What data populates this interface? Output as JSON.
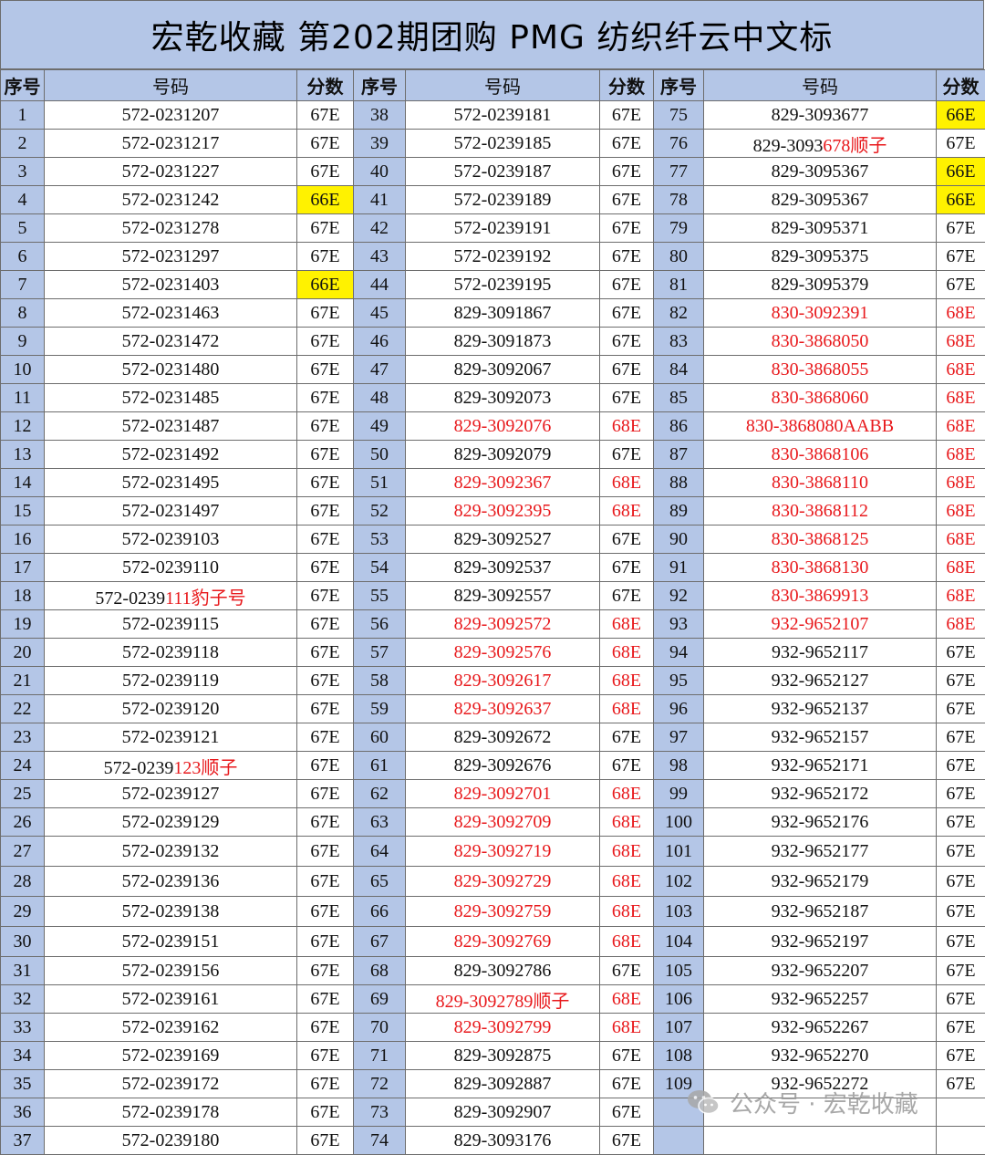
{
  "title": "宏乾收藏  第202期团购    PMG  纺织纤云中文标",
  "header": {
    "seq": "序号",
    "code": "号码",
    "score": "分数"
  },
  "rows": [
    [
      {
        "n": "1",
        "c": "572-0231207",
        "s": "67E"
      },
      {
        "n": "38",
        "c": "572-0239181",
        "s": "67E"
      },
      {
        "n": "75",
        "c": "829-3093677",
        "s": "66E",
        "hl": true
      }
    ],
    [
      {
        "n": "2",
        "c": "572-0231217",
        "s": "67E"
      },
      {
        "n": "39",
        "c": "572-0239185",
        "s": "67E"
      },
      {
        "n": "76",
        "c": "829-3093",
        "cr": "678顺子",
        "s": "67E"
      }
    ],
    [
      {
        "n": "3",
        "c": "572-0231227",
        "s": "67E"
      },
      {
        "n": "40",
        "c": "572-0239187",
        "s": "67E"
      },
      {
        "n": "77",
        "c": "829-3095367",
        "s": "66E",
        "hl": true
      }
    ],
    [
      {
        "n": "4",
        "c": "572-0231242",
        "s": "66E",
        "hl": true
      },
      {
        "n": "41",
        "c": "572-0239189",
        "s": "67E"
      },
      {
        "n": "78",
        "c": "829-3095367",
        "s": "66E",
        "hl": true
      }
    ],
    [
      {
        "n": "5",
        "c": "572-0231278",
        "s": "67E"
      },
      {
        "n": "42",
        "c": "572-0239191",
        "s": "67E"
      },
      {
        "n": "79",
        "c": "829-3095371",
        "s": "67E"
      }
    ],
    [
      {
        "n": "6",
        "c": "572-0231297",
        "s": "67E"
      },
      {
        "n": "43",
        "c": "572-0239192",
        "s": "67E"
      },
      {
        "n": "80",
        "c": "829-3095375",
        "s": "67E"
      }
    ],
    [
      {
        "n": "7",
        "c": "572-0231403",
        "s": "66E",
        "hl": true
      },
      {
        "n": "44",
        "c": "572-0239195",
        "s": "67E"
      },
      {
        "n": "81",
        "c": "829-3095379",
        "s": "67E"
      }
    ],
    [
      {
        "n": "8",
        "c": "572-0231463",
        "s": "67E"
      },
      {
        "n": "45",
        "c": "829-3091867",
        "s": "67E"
      },
      {
        "n": "82",
        "c": "830-3092391",
        "s": "68E",
        "red": true
      }
    ],
    [
      {
        "n": "9",
        "c": "572-0231472",
        "s": "67E"
      },
      {
        "n": "46",
        "c": "829-3091873",
        "s": "67E"
      },
      {
        "n": "83",
        "c": "830-3868050",
        "s": "68E",
        "red": true
      }
    ],
    [
      {
        "n": "10",
        "c": "572-0231480",
        "s": "67E"
      },
      {
        "n": "47",
        "c": "829-3092067",
        "s": "67E"
      },
      {
        "n": "84",
        "c": "830-3868055",
        "s": "68E",
        "red": true
      }
    ],
    [
      {
        "n": "11",
        "c": "572-0231485",
        "s": "67E"
      },
      {
        "n": "48",
        "c": "829-3092073",
        "s": "67E"
      },
      {
        "n": "85",
        "c": "830-3868060",
        "s": "68E",
        "red": true
      }
    ],
    [
      {
        "n": "12",
        "c": "572-0231487",
        "s": "67E"
      },
      {
        "n": "49",
        "c": "829-3092076",
        "s": "68E",
        "red": true
      },
      {
        "n": "86",
        "c": "830-3868080AABB",
        "s": "68E",
        "red": true
      }
    ],
    [
      {
        "n": "13",
        "c": "572-0231492",
        "s": "67E"
      },
      {
        "n": "50",
        "c": "829-3092079",
        "s": "67E"
      },
      {
        "n": "87",
        "c": "830-3868106",
        "s": "68E",
        "red": true
      }
    ],
    [
      {
        "n": "14",
        "c": "572-0231495",
        "s": "67E"
      },
      {
        "n": "51",
        "c": "829-3092367",
        "s": "68E",
        "red": true
      },
      {
        "n": "88",
        "c": "830-3868110",
        "s": "68E",
        "red": true
      }
    ],
    [
      {
        "n": "15",
        "c": "572-0231497",
        "s": "67E"
      },
      {
        "n": "52",
        "c": "829-3092395",
        "s": "68E",
        "red": true
      },
      {
        "n": "89",
        "c": "830-3868112",
        "s": "68E",
        "red": true
      }
    ],
    [
      {
        "n": "16",
        "c": "572-0239103",
        "s": "67E"
      },
      {
        "n": "53",
        "c": "829-3092527",
        "s": "67E"
      },
      {
        "n": "90",
        "c": "830-3868125",
        "s": "68E",
        "red": true
      }
    ],
    [
      {
        "n": "17",
        "c": "572-0239110",
        "s": "67E"
      },
      {
        "n": "54",
        "c": "829-3092537",
        "s": "67E"
      },
      {
        "n": "91",
        "c": "830-3868130",
        "s": "68E",
        "red": true
      }
    ],
    [
      {
        "n": "18",
        "c": "572-0239",
        "cr": "111豹子号",
        "s": "67E"
      },
      {
        "n": "55",
        "c": "829-3092557",
        "s": "67E"
      },
      {
        "n": "92",
        "c": "830-3869913",
        "s": "68E",
        "red": true
      }
    ],
    [
      {
        "n": "19",
        "c": "572-0239115",
        "s": "67E"
      },
      {
        "n": "56",
        "c": "829-3092572",
        "s": "68E",
        "red": true
      },
      {
        "n": "93",
        "c": "932-9652107",
        "s": "68E",
        "red": true
      }
    ],
    [
      {
        "n": "20",
        "c": "572-0239118",
        "s": "67E"
      },
      {
        "n": "57",
        "c": "829-3092576",
        "s": "68E",
        "red": true
      },
      {
        "n": "94",
        "c": "932-9652117",
        "s": "67E"
      }
    ],
    [
      {
        "n": "21",
        "c": "572-0239119",
        "s": "67E"
      },
      {
        "n": "58",
        "c": "829-3092617",
        "s": "68E",
        "red": true
      },
      {
        "n": "95",
        "c": "932-9652127",
        "s": "67E"
      }
    ],
    [
      {
        "n": "22",
        "c": "572-0239120",
        "s": "67E"
      },
      {
        "n": "59",
        "c": "829-3092637",
        "s": "68E",
        "red": true
      },
      {
        "n": "96",
        "c": "932-9652137",
        "s": "67E"
      }
    ],
    [
      {
        "n": "23",
        "c": "572-0239121",
        "s": "67E"
      },
      {
        "n": "60",
        "c": "829-3092672",
        "s": "67E"
      },
      {
        "n": "97",
        "c": "932-9652157",
        "s": "67E"
      }
    ],
    [
      {
        "n": "24",
        "c": "572-0239",
        "cr": "123顺子",
        "s": "67E"
      },
      {
        "n": "61",
        "c": "829-3092676",
        "s": "67E"
      },
      {
        "n": "98",
        "c": "932-9652171",
        "s": "67E"
      }
    ],
    [
      {
        "n": "25",
        "c": "572-0239127",
        "s": "67E"
      },
      {
        "n": "62",
        "c": "829-3092701",
        "s": "68E",
        "red": true
      },
      {
        "n": "99",
        "c": "932-9652172",
        "s": "67E"
      }
    ],
    [
      {
        "n": "26",
        "c": "572-0239129",
        "s": "67E"
      },
      {
        "n": "63",
        "c": "829-3092709",
        "s": "68E",
        "red": true
      },
      {
        "n": "100",
        "c": "932-9652176",
        "s": "67E"
      }
    ],
    [
      {
        "n": "27",
        "c": "572-0239132",
        "s": "67E"
      },
      {
        "n": "64",
        "c": "829-3092719",
        "s": "68E",
        "red": true
      },
      {
        "n": "101",
        "c": "932-9652177",
        "s": "67E"
      }
    ],
    [
      {
        "n": "28",
        "c": "572-0239136",
        "s": "67E"
      },
      {
        "n": "65",
        "c": "829-3092729",
        "s": "68E",
        "red": true
      },
      {
        "n": "102",
        "c": "932-9652179",
        "s": "67E"
      }
    ],
    [
      {
        "n": "29",
        "c": "572-0239138",
        "s": "67E"
      },
      {
        "n": "66",
        "c": "829-3092759",
        "s": "68E",
        "red": true
      },
      {
        "n": "103",
        "c": "932-9652187",
        "s": "67E"
      }
    ],
    [
      {
        "n": "30",
        "c": "572-0239151",
        "s": "67E"
      },
      {
        "n": "67",
        "c": "829-3092769",
        "s": "68E",
        "red": true
      },
      {
        "n": "104",
        "c": "932-9652197",
        "s": "67E"
      }
    ],
    [
      {
        "n": "31",
        "c": "572-0239156",
        "s": "67E"
      },
      {
        "n": "68",
        "c": "829-3092786",
        "s": "67E"
      },
      {
        "n": "105",
        "c": "932-9652207",
        "s": "67E"
      }
    ],
    [
      {
        "n": "32",
        "c": "572-0239161",
        "s": "67E"
      },
      {
        "n": "69",
        "c": "829-3092789顺子",
        "s": "68E",
        "red": true
      },
      {
        "n": "106",
        "c": "932-9652257",
        "s": "67E"
      }
    ],
    [
      {
        "n": "33",
        "c": "572-0239162",
        "s": "67E"
      },
      {
        "n": "70",
        "c": "829-3092799",
        "s": "68E",
        "red": true
      },
      {
        "n": "107",
        "c": "932-9652267",
        "s": "67E"
      }
    ],
    [
      {
        "n": "34",
        "c": "572-0239169",
        "s": "67E"
      },
      {
        "n": "71",
        "c": "829-3092875",
        "s": "67E"
      },
      {
        "n": "108",
        "c": "932-9652270",
        "s": "67E"
      }
    ],
    [
      {
        "n": "35",
        "c": "572-0239172",
        "s": "67E"
      },
      {
        "n": "72",
        "c": "829-3092887",
        "s": "67E"
      },
      {
        "n": "109",
        "c": "932-9652272",
        "s": "67E"
      }
    ],
    [
      {
        "n": "36",
        "c": "572-0239178",
        "s": "67E"
      },
      {
        "n": "73",
        "c": "829-3092907",
        "s": "67E"
      },
      {
        "n": "",
        "c": "",
        "s": ""
      }
    ],
    [
      {
        "n": "37",
        "c": "572-0239180",
        "s": "67E"
      },
      {
        "n": "74",
        "c": "829-3093176",
        "s": "67E"
      },
      {
        "n": "",
        "c": "",
        "s": ""
      }
    ]
  ],
  "watermark": {
    "text": "公众号 · 宏乾收藏",
    "icon": "wechat-icon"
  },
  "colors": {
    "header_bg": "#b4c6e7",
    "highlight": "#fff200",
    "red_text": "#e8191c"
  }
}
